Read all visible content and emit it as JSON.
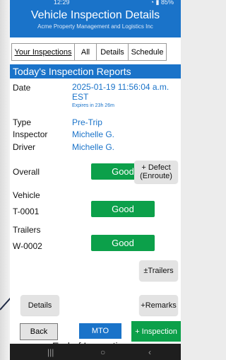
{
  "status": {
    "time": "12:29",
    "right": "85%"
  },
  "header": {
    "title": "Vehicle Inspection Details",
    "subtitle": "Acme Property Management and Logistics Inc"
  },
  "tabs": [
    {
      "label": "Your Inspections"
    },
    {
      "label": "All"
    },
    {
      "label": "Details"
    },
    {
      "label": "Schedule"
    }
  ],
  "reports": {
    "title": "Today's Inspection Reports",
    "date_label": "Date",
    "date_value": "2025-01-19 11:56:04 a.m.",
    "tz": "EST",
    "expires": "Expires in 23h 26m",
    "type_label": "Type",
    "type_value": "Pre-Trip",
    "inspector_label": "Inspector",
    "inspector_value": "Michelle G.",
    "driver_label": "Driver",
    "driver_value": "Michelle G.",
    "overall_label": "Overall",
    "overall_status": "Good",
    "defect_button": "+ Defect (Enroute)",
    "vehicle_label": "Vehicle",
    "vehicle_id": "T-0001",
    "vehicle_status": "Good",
    "trailers_label": "Trailers",
    "trailer_id": "W-0002",
    "trailer_status": "Good",
    "trailers_button": "±Trailers",
    "details_button": "Details",
    "remarks_button": "+Remarks"
  },
  "bottom": {
    "back": "Back",
    "mto": "MTO",
    "inspection": "+ Inspection",
    "end_text": "End of Inspections"
  },
  "colors": {
    "primary": "#1a73c9",
    "good": "#0ca04a"
  }
}
